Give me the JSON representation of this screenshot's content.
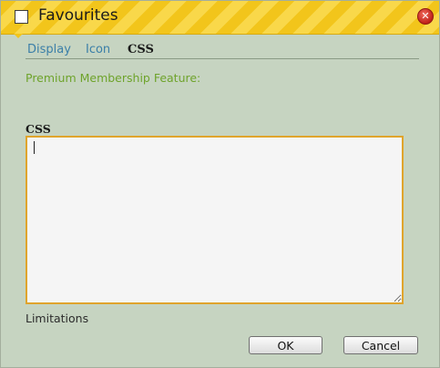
{
  "dialog": {
    "title": "Favourites",
    "close_icon_glyph": "✕"
  },
  "tabs": [
    {
      "label": "Display"
    },
    {
      "label": "Icon"
    },
    {
      "label": "CSS"
    }
  ],
  "premium_notice": "Premium Membership Feature:",
  "css_field": {
    "label": "CSS",
    "value": ""
  },
  "limitations_link": "Limitations",
  "buttons": {
    "ok": "OK",
    "cancel": "Cancel"
  },
  "colors": {
    "title_stripe_a": "#f2c51b",
    "title_stripe_b": "#f9d84a",
    "dialog_bg": "#c6d4c1",
    "link": "#3b7fa8",
    "premium": "#6ea32b",
    "textarea_border": "#e0a42c",
    "close_button": "#c0221a"
  }
}
